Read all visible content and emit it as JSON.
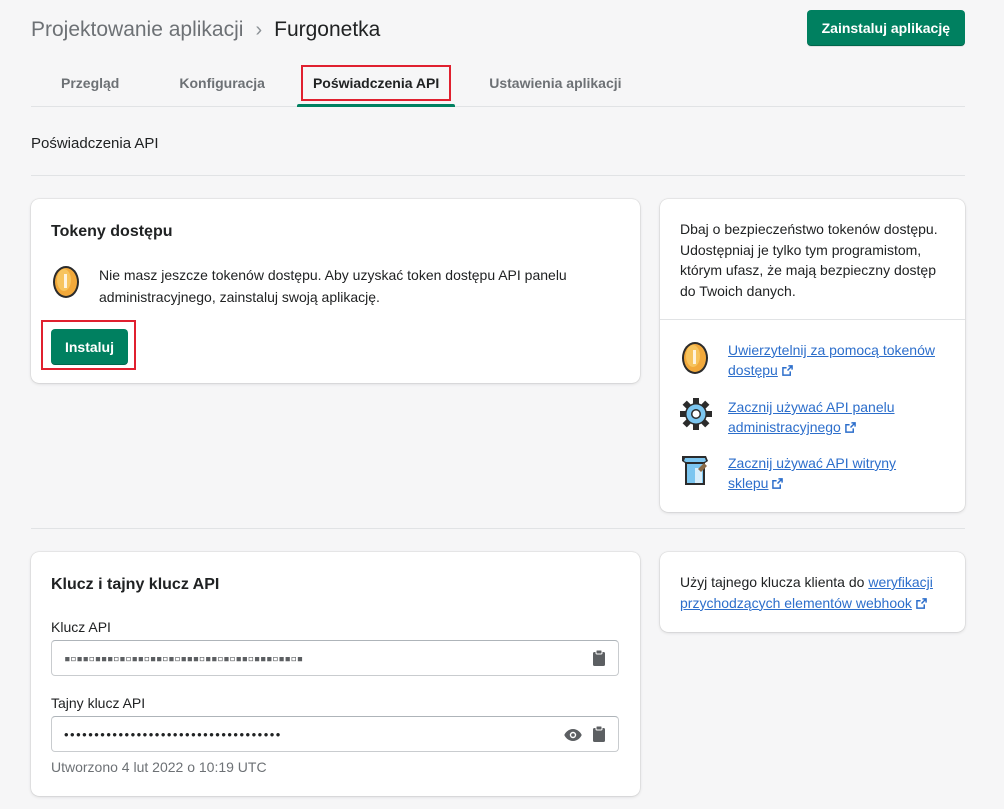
{
  "header": {
    "breadcrumb_parent": "Projektowanie aplikacji",
    "breadcrumb_separator": "›",
    "title": "Furgonetka",
    "install_app_button": "Zainstaluj aplikację"
  },
  "tabs": [
    {
      "label": "Przegląd",
      "active": false
    },
    {
      "label": "Konfiguracja",
      "active": false
    },
    {
      "label": "Poświadczenia API",
      "active": true
    },
    {
      "label": "Ustawienia aplikacji",
      "active": false
    }
  ],
  "section_title": "Poświadczenia API",
  "tokens_card": {
    "title": "Tokeny dostępu",
    "message": "Nie masz jeszcze tokenów dostępu. Aby uzyskać token dostępu API panelu administracyjnego, zainstaluj swoją aplikację.",
    "install_button": "Instaluj"
  },
  "security_card": {
    "text": "Dbaj o bezpieczeństwo tokenów dostępu. Udostępniaj je tylko tym programistom, którym ufasz, że mają bezpieczny dostęp do Twoich danych.",
    "links": [
      {
        "line1": "Uwierzytelnij za pomocą tokenów",
        "line2": "dostępu",
        "icon": "coin-icon"
      },
      {
        "line1": "Zacznij używać API panelu",
        "line2": "administracyjnego",
        "icon": "gear-icon"
      },
      {
        "line1": "Zacznij używać API witryny",
        "line2": "sklepu",
        "icon": "storefront-icon"
      }
    ]
  },
  "api_keys_card": {
    "title": "Klucz i tajny klucz API",
    "api_key_label": "Klucz API",
    "api_key_value": "▪▫▪▪▫▪▪▪▫▪▫▪▪▫▪▪▫▪▫▪▪▪▫▪▪▫▪▫▪▪▫▪▪▪▫▪▪▫▪",
    "secret_label": "Tajny klucz API",
    "secret_value": "••••••••••••••••••••••••••••••••••••",
    "created": "Utworzono 4 lut 2022 o 10:19 UTC"
  },
  "webhook_card": {
    "text_prefix": "Użyj tajnego klucza klienta do ",
    "link_line1": "weryfikacji",
    "link_line2": "przychodzących elementów webhook"
  },
  "colors": {
    "primary": "#008060",
    "link": "#2c6ecb",
    "highlight": "#e0202f"
  }
}
